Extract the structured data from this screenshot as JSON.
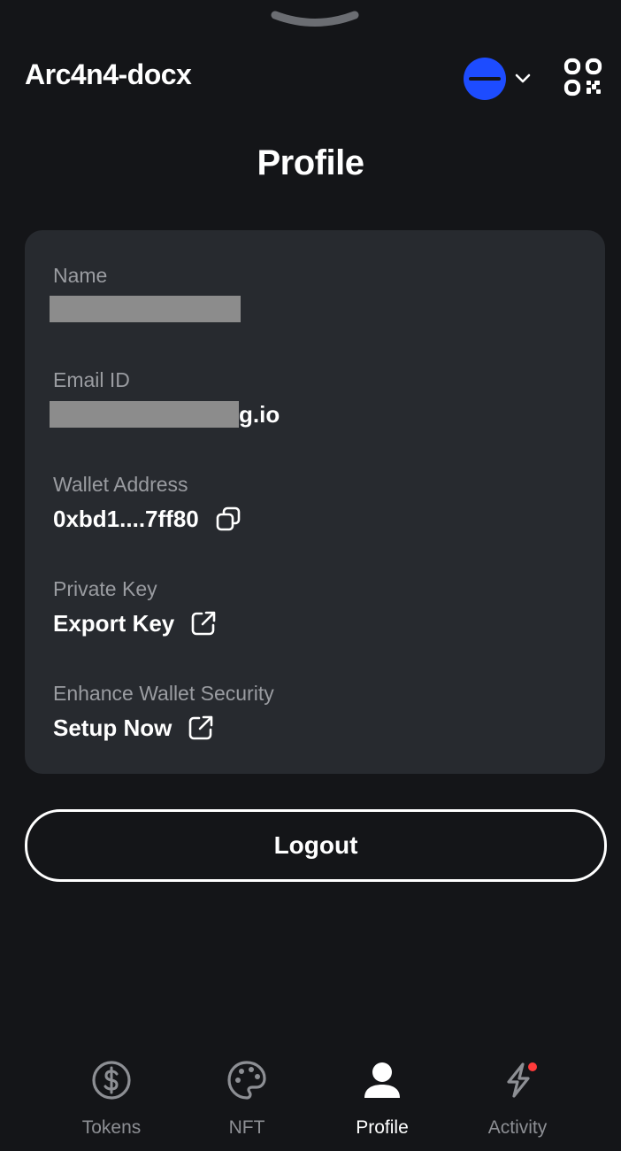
{
  "header": {
    "app_name": "Arc4n4-docx",
    "network_color": "#1d4cff"
  },
  "page": {
    "title": "Profile"
  },
  "profile": {
    "name_label": "Name",
    "email_label": "Email ID",
    "email_visible_suffix": "g.io",
    "wallet_label": "Wallet Address",
    "wallet_value": "0xbd1....7ff80",
    "private_key_label": "Private Key",
    "export_key_label": "Export Key",
    "security_label": "Enhance Wallet Security",
    "setup_now_label": "Setup Now"
  },
  "actions": {
    "logout_label": "Logout"
  },
  "nav": {
    "items": [
      {
        "label": "Tokens",
        "icon": "dollar-circle-icon",
        "active": false
      },
      {
        "label": "NFT",
        "icon": "palette-icon",
        "active": false
      },
      {
        "label": "Profile",
        "icon": "user-icon",
        "active": true
      },
      {
        "label": "Activity",
        "icon": "lightning-icon",
        "active": false,
        "badge": true
      }
    ]
  },
  "colors": {
    "background": "#141518",
    "card": "#272a2f",
    "accent": "#1d4cff",
    "badge": "#ff3b3b",
    "muted_text": "#8d8f94"
  }
}
